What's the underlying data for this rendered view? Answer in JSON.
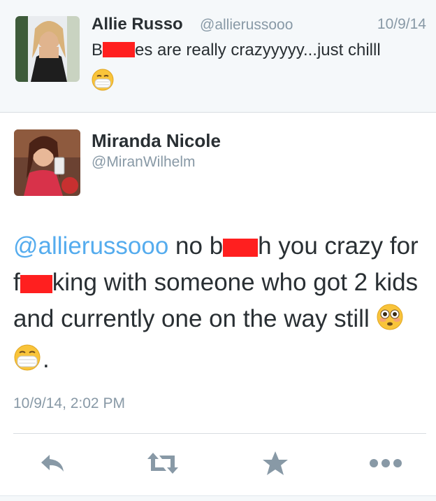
{
  "reply_tweet": {
    "name": "Allie Russo",
    "handle": "@allierussooo",
    "date": "10/9/14",
    "text_start": "B",
    "text_end": "es are really crazyyyyy...just chilll",
    "emoji": "mask-face-emoji"
  },
  "main_tweet": {
    "name": "Miranda Nicole",
    "handle": "@MiranWilhelm",
    "mention": "@allierussooo",
    "text_1": " no b",
    "text_2": "h you crazy for f",
    "text_3": "king with someone who got 2 kids and currently one on the way still ",
    "text_end": ".",
    "timestamp": "10/9/14, 2:02 PM"
  },
  "colors": {
    "link": "#55acee",
    "muted": "#8899a6",
    "text": "#292f33",
    "redaction": "#ff1f1f"
  },
  "actions": [
    "reply-icon",
    "retweet-icon",
    "favorite-icon",
    "more-icon"
  ]
}
